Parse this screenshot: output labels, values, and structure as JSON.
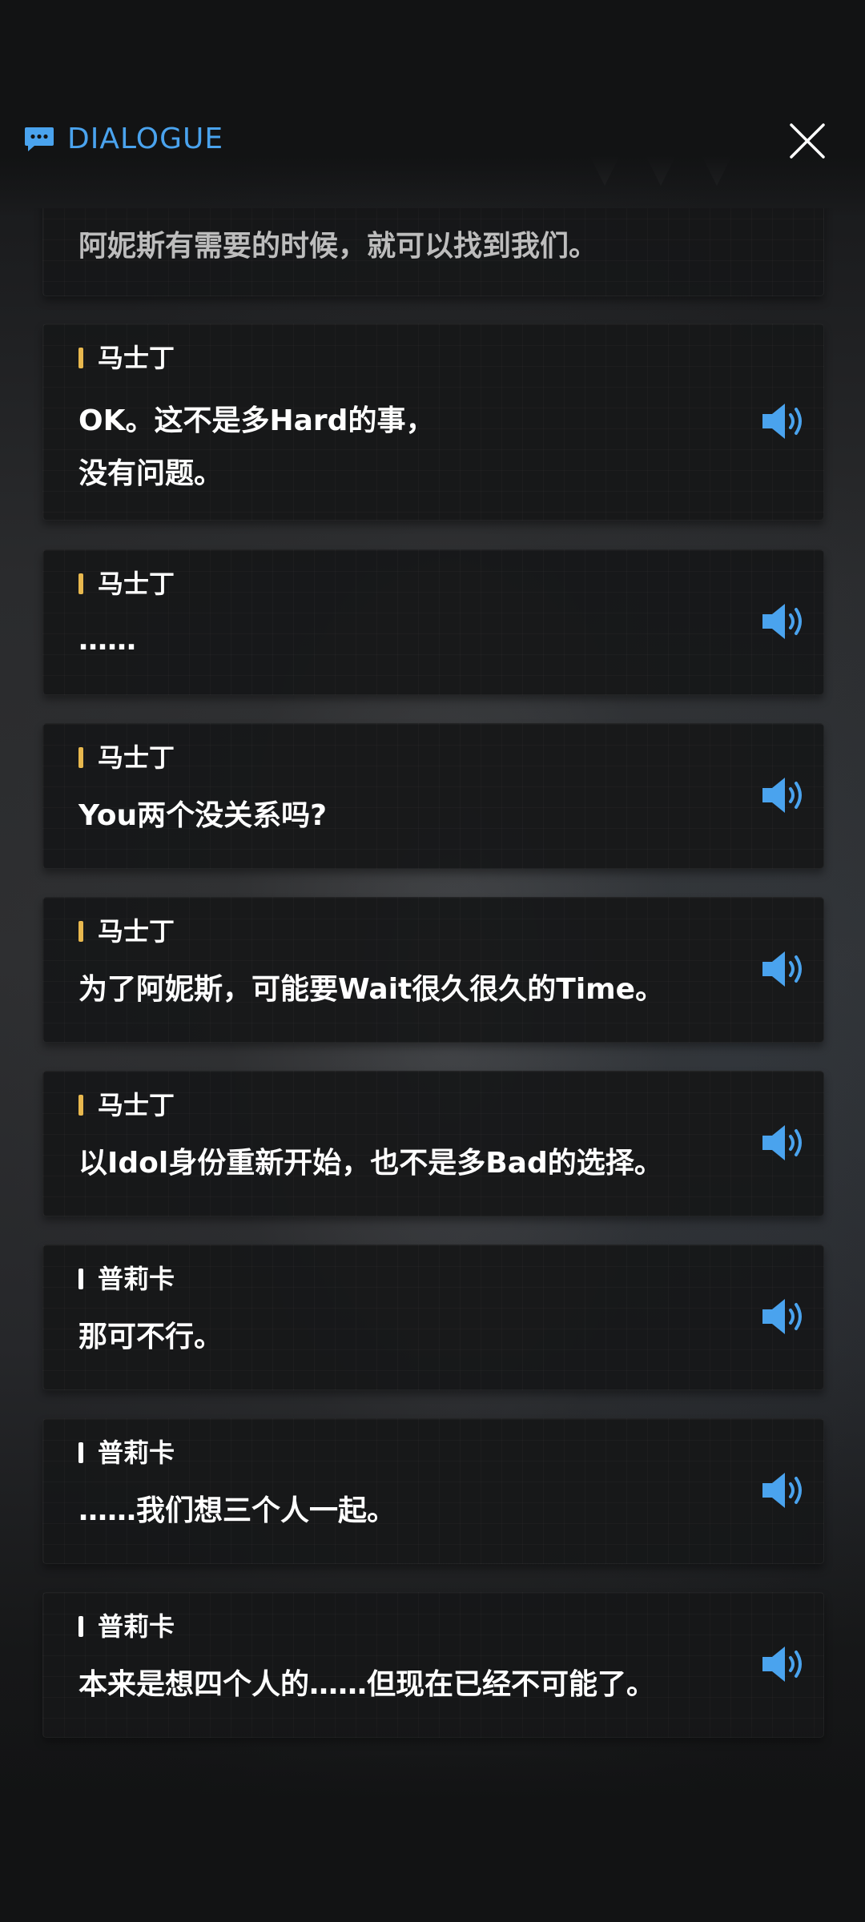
{
  "header": {
    "title": "DIALOGUE",
    "accent_color": "#4aa3ee",
    "icon": "chat-bubble-icon",
    "close_icon": "close-icon"
  },
  "entries": [
    {
      "speaker": "",
      "text": "阿妮斯有需要的时候，就可以找到我们。",
      "has_voice": false
    },
    {
      "speaker": "马士丁",
      "speaker_color": "#e8b84e",
      "text": "OK。这不是多Hard的事，\n没有问题。",
      "has_voice": true
    },
    {
      "speaker": "马士丁",
      "speaker_color": "#e8b84e",
      "text": "……",
      "has_voice": true
    },
    {
      "speaker": "马士丁",
      "speaker_color": "#e8b84e",
      "text": "You两个没关系吗?",
      "has_voice": true
    },
    {
      "speaker": "马士丁",
      "speaker_color": "#e8b84e",
      "text": "为了阿妮斯，可能要Wait很久很久的Time。",
      "has_voice": true
    },
    {
      "speaker": "马士丁",
      "speaker_color": "#e8b84e",
      "text": "以Idol身份重新开始，也不是多Bad的选择。",
      "has_voice": true
    },
    {
      "speaker": "普莉卡",
      "speaker_color": "#ffffff",
      "text": "那可不行。",
      "has_voice": true
    },
    {
      "speaker": "普莉卡",
      "speaker_color": "#ffffff",
      "text": "……我们想三个人一起。",
      "has_voice": true
    },
    {
      "speaker": "普莉卡",
      "speaker_color": "#ffffff",
      "text": "本来是想四个人的……但现在已经不可能了。",
      "has_voice": true
    }
  ],
  "voice_icon": "speaker-volume-icon",
  "voice_icon_color": "#4aa3ee"
}
